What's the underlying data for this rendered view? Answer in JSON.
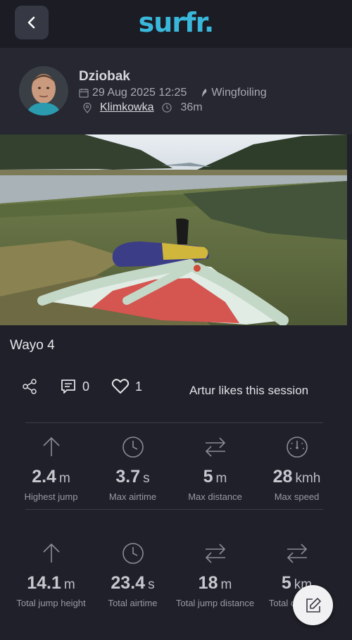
{
  "app": {
    "logo_text": "surfr."
  },
  "session": {
    "user_name": "Dziobak",
    "date": "29 Aug 2025 12:25",
    "sport": "Wingfoiling",
    "location": "Klimkowka",
    "duration": "36m",
    "title": "Wayo 4"
  },
  "social": {
    "comments_count": "0",
    "likes_count": "1",
    "likes_text": "Artur likes this session"
  },
  "stats_row1": [
    {
      "icon": "arrow-up-icon",
      "value": "2.4",
      "unit": "m",
      "label": "Highest jump"
    },
    {
      "icon": "clock-icon",
      "value": "3.7",
      "unit": "s",
      "label": "Max airtime"
    },
    {
      "icon": "transfer-arrows-icon",
      "value": "5",
      "unit": "m",
      "label": "Max distance"
    },
    {
      "icon": "speedometer-icon",
      "value": "28",
      "unit": "kmh",
      "label": "Max speed"
    }
  ],
  "stats_row2": [
    {
      "icon": "arrow-up-icon",
      "value": "14.1",
      "unit": "m",
      "label": "Total jump height"
    },
    {
      "icon": "clock-icon",
      "value": "23.4",
      "unit": "s",
      "label": "Total airtime"
    },
    {
      "icon": "transfer-arrows-icon",
      "value": "18",
      "unit": "m",
      "label": "Total jump distance"
    },
    {
      "icon": "transfer-arrows-icon",
      "value": "5",
      "unit": "km",
      "label": "Total distance"
    }
  ],
  "colors": {
    "accent": "#3ab8db",
    "background": "#1f2029",
    "header": "#262730"
  }
}
